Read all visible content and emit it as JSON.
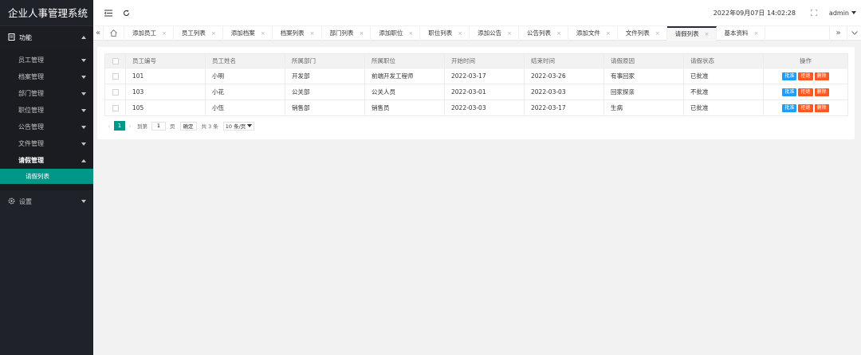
{
  "app": {
    "title": "企业人事管理系统"
  },
  "sidebar": {
    "groups": [
      {
        "label": "功能",
        "icon": "document-icon",
        "expanded": true,
        "items": [
          {
            "label": "员工管理"
          },
          {
            "label": "档案管理"
          },
          {
            "label": "部门管理"
          },
          {
            "label": "职位管理"
          },
          {
            "label": "公告管理"
          },
          {
            "label": "文件管理"
          },
          {
            "label": "请假管理",
            "expanded": true,
            "children": [
              {
                "label": "请假列表"
              }
            ]
          }
        ]
      },
      {
        "label": "设置",
        "icon": "gear-icon",
        "expanded": false
      }
    ]
  },
  "header": {
    "datetime": "2022年09月07日 14:02:28",
    "user": "admin"
  },
  "tabs": [
    {
      "label": "添加员工"
    },
    {
      "label": "员工列表"
    },
    {
      "label": "添加档案"
    },
    {
      "label": "档案列表"
    },
    {
      "label": "部门列表"
    },
    {
      "label": "添加职位"
    },
    {
      "label": "职位列表"
    },
    {
      "label": "添加公告"
    },
    {
      "label": "公告列表"
    },
    {
      "label": "添加文件"
    },
    {
      "label": "文件列表"
    },
    {
      "label": "请假列表",
      "active": true
    },
    {
      "label": "基本资料"
    }
  ],
  "table": {
    "columns": [
      "员工编号",
      "员工姓名",
      "所属部门",
      "所属职位",
      "开始时间",
      "结束时间",
      "请假原因",
      "请假状态",
      "操作"
    ],
    "rows": [
      {
        "id": "101",
        "name": "小明",
        "dept": "开发部",
        "position": "前端开发工程师",
        "start": "2022-03-17",
        "end": "2022-03-26",
        "reason": "有事回家",
        "status": "已批准"
      },
      {
        "id": "103",
        "name": "小花",
        "dept": "公关部",
        "position": "公关人员",
        "start": "2022-03-01",
        "end": "2022-03-03",
        "reason": "回家探亲",
        "status": "不批准"
      },
      {
        "id": "105",
        "name": "小伍",
        "dept": "销售部",
        "position": "销售员",
        "start": "2022-03-03",
        "end": "2022-03-17",
        "reason": "生病",
        "status": "已批准"
      }
    ],
    "actions": {
      "approve": "批准",
      "reject": "拒绝",
      "delete": "删除"
    }
  },
  "pager": {
    "current": "1",
    "goto_label": "到第",
    "page_value": "1",
    "page_unit": "页",
    "confirm": "确定",
    "total": "共 3 条",
    "page_size": "10 条/页"
  }
}
